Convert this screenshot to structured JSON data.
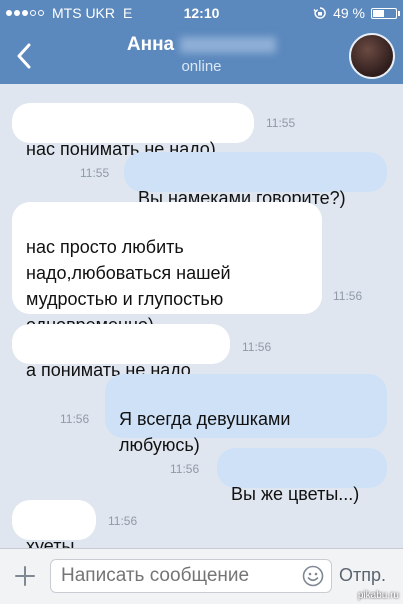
{
  "status_bar": {
    "carrier": "MTS UKR",
    "network": "E",
    "time": "12:10",
    "battery": "49 %",
    "battery_level": 0.49,
    "signal_bars": 3
  },
  "nav": {
    "contact_name": "Анна",
    "status": "online"
  },
  "messages": [
    {
      "direction": "in",
      "text": "нас понимать не надо)",
      "time": "11:55"
    },
    {
      "direction": "out",
      "text": "Вы намеками говорите?)",
      "time": "11:55"
    },
    {
      "direction": "in",
      "text": "нас просто любить\nнадо,любоваться нашей\nмудростью и глупостью\nодновременно)",
      "time": "11:56"
    },
    {
      "direction": "in",
      "text": "а понимать не надо",
      "time": "11:56"
    },
    {
      "direction": "out",
      "text": "Я всегда девушками\nлюбуюсь)",
      "time": "11:56"
    },
    {
      "direction": "out",
      "text": "Вы же цветы...)",
      "time": "11:56"
    },
    {
      "direction": "in",
      "text": "хуеты",
      "time": "11:56"
    }
  ],
  "composer": {
    "placeholder": "Написать сообщение",
    "send_label": "Отпр."
  },
  "watermark": "pikabu.ru",
  "colors": {
    "header": "#5b88bd",
    "background": "#dfe6ef",
    "incoming_bubble": "#ffffff",
    "outgoing_bubble": "#cfe1f7"
  }
}
